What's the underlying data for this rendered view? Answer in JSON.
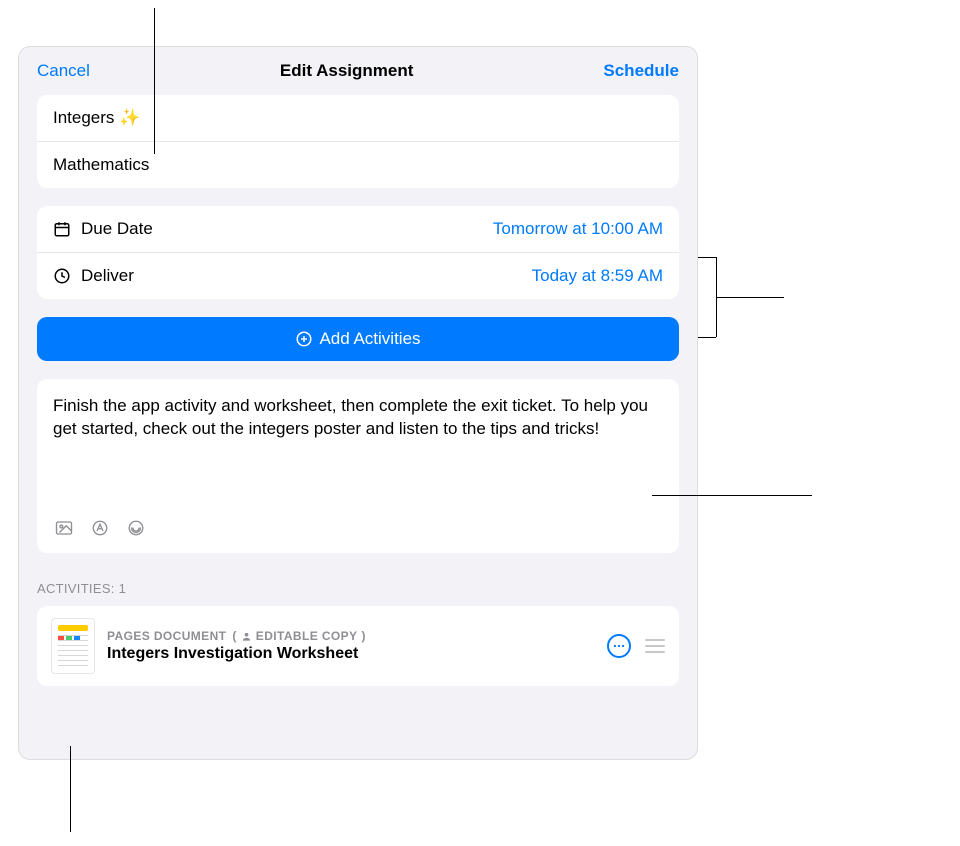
{
  "header": {
    "cancel": "Cancel",
    "title": "Edit Assignment",
    "schedule": "Schedule"
  },
  "assignment": {
    "title": "Integers ✨",
    "class": "Mathematics"
  },
  "schedule_rows": {
    "due_label": "Due Date",
    "due_value": "Tomorrow at 10:00 AM",
    "deliver_label": "Deliver",
    "deliver_value": "Today at 8:59 AM"
  },
  "add_activities_label": "Add Activities",
  "instructions": "Finish the app activity and worksheet, then complete the exit ticket. To help you get started, check out the integers poster and listen to the tips and tricks!",
  "activities": {
    "section_label": "Activities: 1",
    "item": {
      "type": "PAGES DOCUMENT",
      "badge": "EDITABLE COPY",
      "title": "Integers Investigation Worksheet"
    }
  }
}
